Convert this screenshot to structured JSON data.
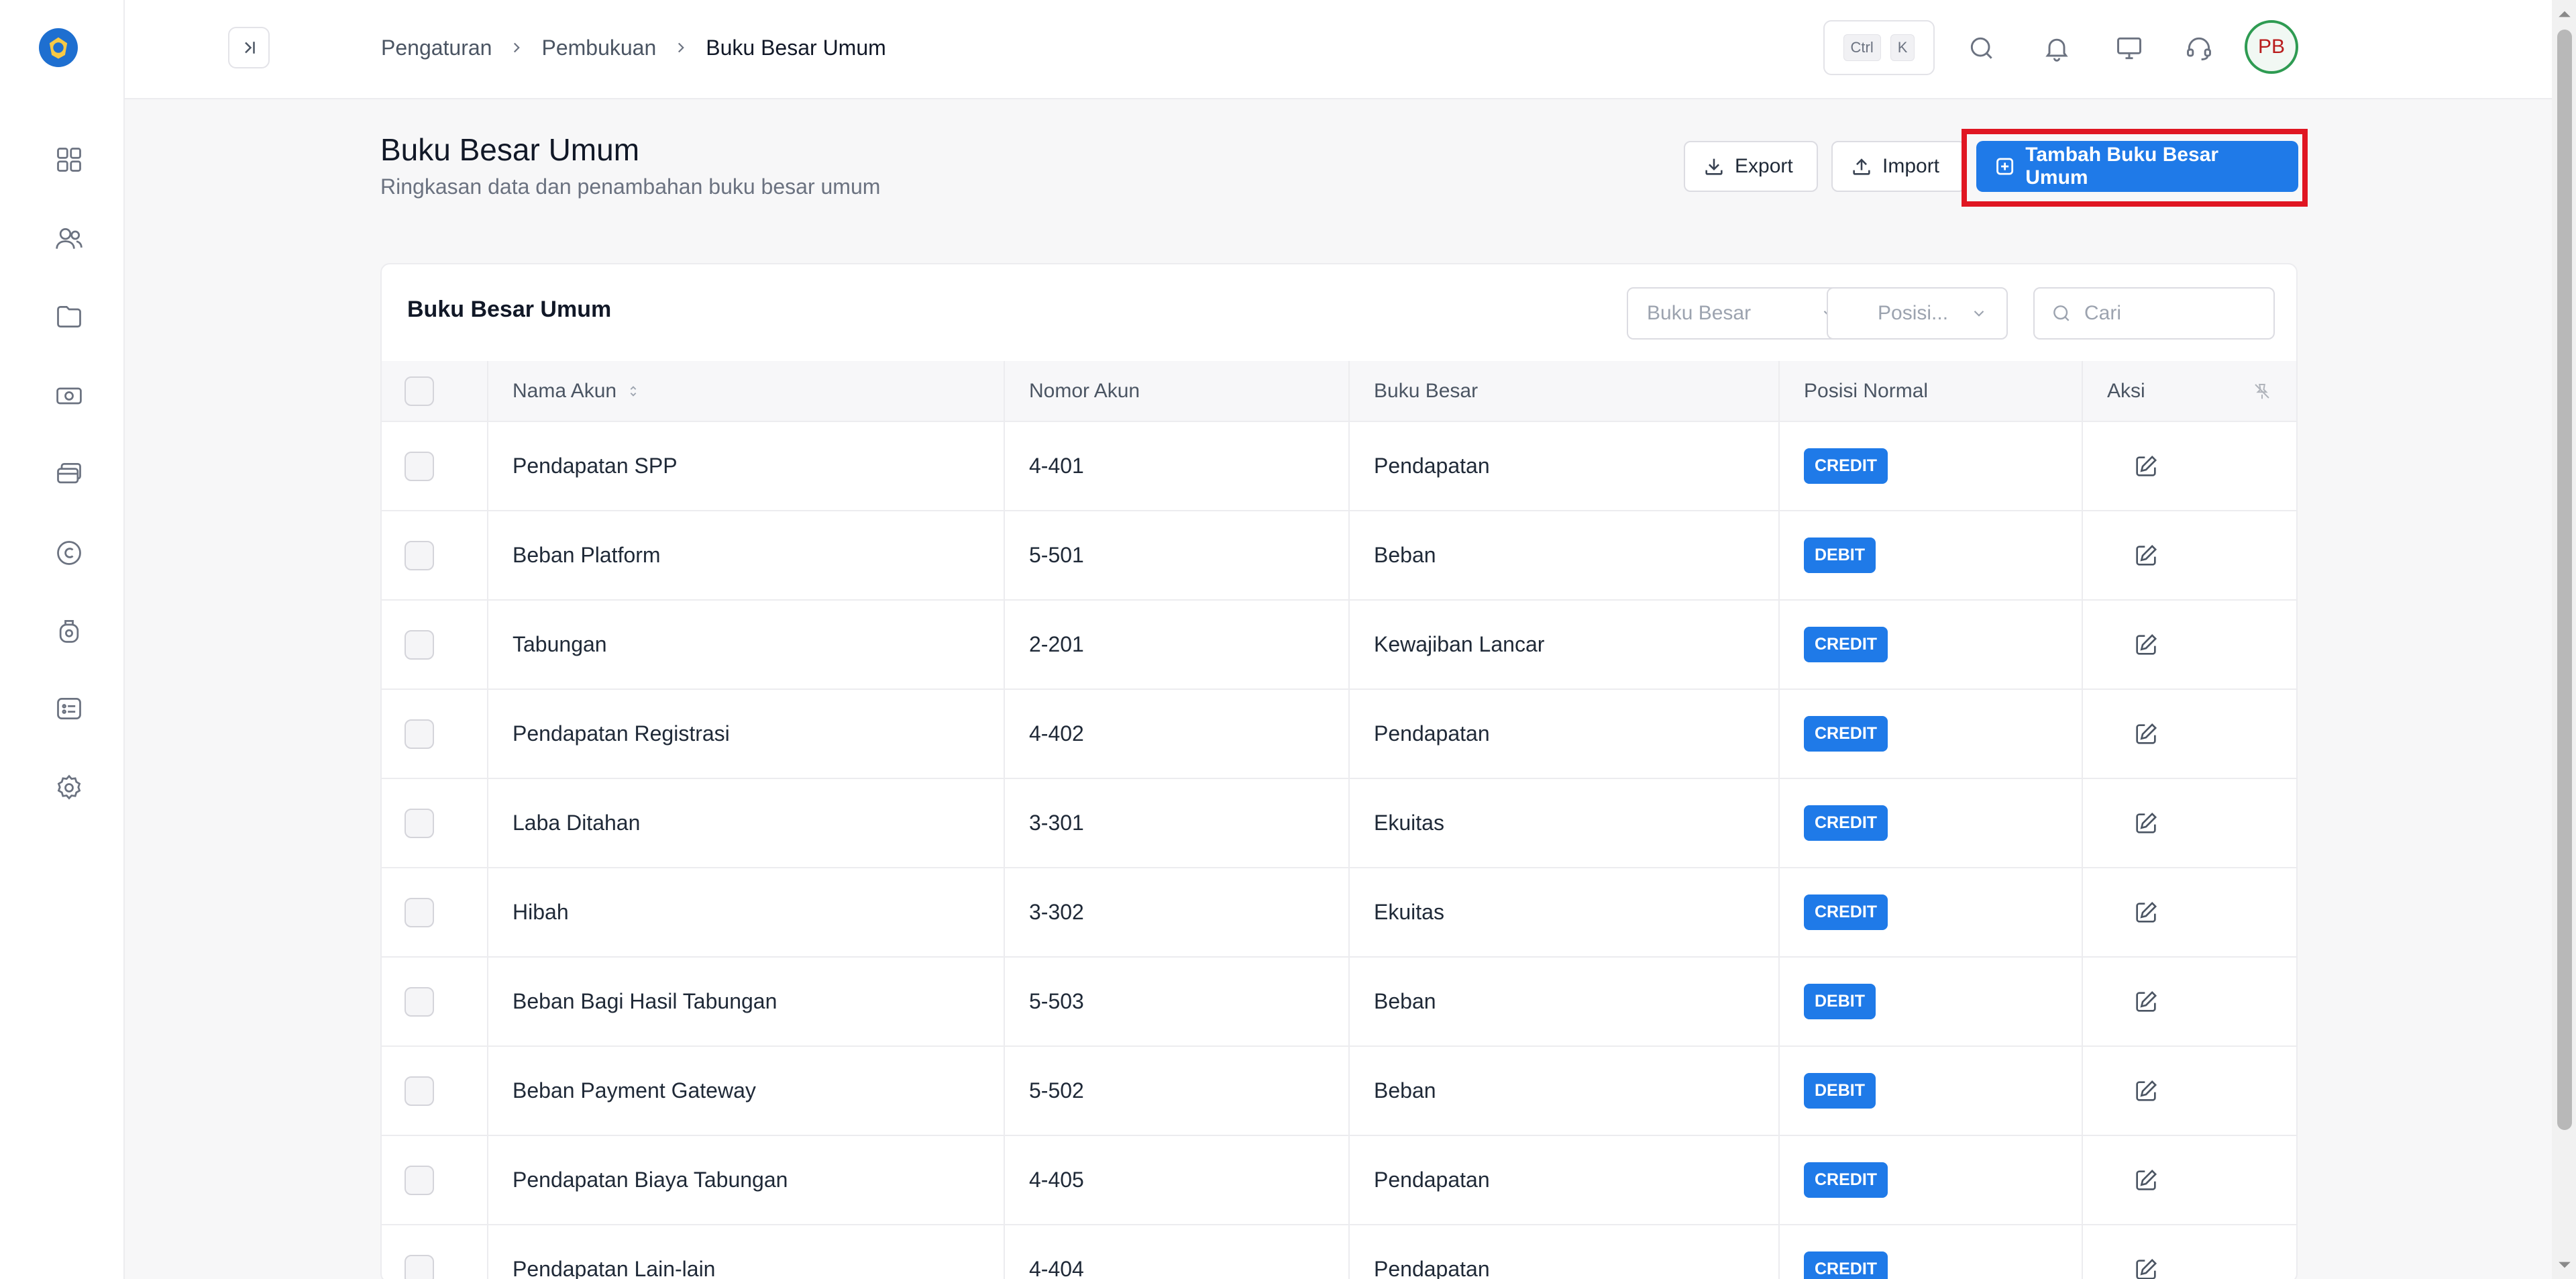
{
  "breadcrumb": {
    "items": [
      "Pengaturan",
      "Pembukuan"
    ],
    "current": "Buku Besar Umum"
  },
  "shortcut": {
    "key1": "Ctrl",
    "key2": "K"
  },
  "user": {
    "initials": "PB"
  },
  "header": {
    "title": "Buku Besar Umum",
    "subtitle": "Ringkasan data dan penambahan buku besar umum",
    "export_label": "Export",
    "import_label": "Import",
    "add_label": "Tambah Buku Besar Umum"
  },
  "card": {
    "title": "Buku Besar Umum",
    "filter_buku_besar": "Buku Besar",
    "filter_posisi": "Posisi...",
    "search_placeholder": "Cari"
  },
  "table": {
    "columns": {
      "nama": "Nama Akun",
      "nomor": "Nomor Akun",
      "buku": "Buku Besar",
      "posisi": "Posisi Normal",
      "aksi": "Aksi"
    },
    "rows": [
      {
        "nama": "Pendapatan SPP",
        "nomor": "4-401",
        "buku": "Pendapatan",
        "posisi": "CREDIT"
      },
      {
        "nama": "Beban Platform",
        "nomor": "5-501",
        "buku": "Beban",
        "posisi": "DEBIT"
      },
      {
        "nama": "Tabungan",
        "nomor": "2-201",
        "buku": "Kewajiban Lancar",
        "posisi": "CREDIT"
      },
      {
        "nama": "Pendapatan Registrasi",
        "nomor": "4-402",
        "buku": "Pendapatan",
        "posisi": "CREDIT"
      },
      {
        "nama": "Laba Ditahan",
        "nomor": "3-301",
        "buku": "Ekuitas",
        "posisi": "CREDIT"
      },
      {
        "nama": "Hibah",
        "nomor": "3-302",
        "buku": "Ekuitas",
        "posisi": "CREDIT"
      },
      {
        "nama": "Beban Bagi Hasil Tabungan",
        "nomor": "5-503",
        "buku": "Beban",
        "posisi": "DEBIT"
      },
      {
        "nama": "Beban Payment Gateway",
        "nomor": "5-502",
        "buku": "Beban",
        "posisi": "DEBIT"
      },
      {
        "nama": "Pendapatan Biaya Tabungan",
        "nomor": "4-405",
        "buku": "Pendapatan",
        "posisi": "CREDIT"
      },
      {
        "nama": "Pendapatan Lain-lain",
        "nomor": "4-404",
        "buku": "Pendapatan",
        "posisi": "CREDIT"
      }
    ]
  },
  "colors": {
    "primary": "#1f7ae8",
    "highlight": "#e01622",
    "avatar_ring": "#2e9b52"
  },
  "icons": {
    "sidebar": [
      "dashboard-icon",
      "users-icon",
      "folder-icon",
      "cash-icon",
      "cards-icon",
      "coin-icon",
      "piggy-icon",
      "list-icon",
      "gear-icon"
    ],
    "topbar": [
      "search-icon",
      "bell-icon",
      "monitor-icon",
      "headset-icon"
    ]
  }
}
